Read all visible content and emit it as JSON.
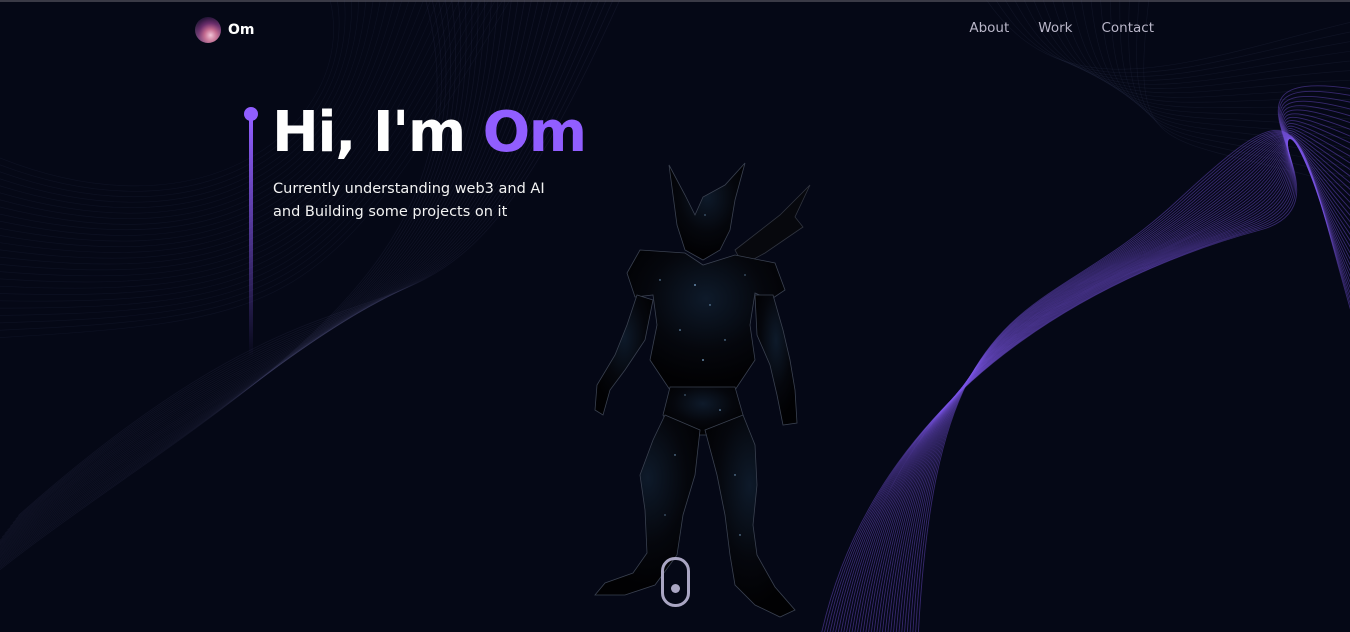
{
  "nav": {
    "brand_name": "Om",
    "links": [
      {
        "label": "About"
      },
      {
        "label": "Work"
      },
      {
        "label": "Contact"
      }
    ]
  },
  "hero": {
    "greeting": "Hi, I'm ",
    "name": "Om",
    "subtitle_line1": "Currently understanding web3 and AI",
    "subtitle_line2": "and Building some projects on it"
  },
  "colors": {
    "background": "#050816",
    "accent": "#915eff",
    "text_secondary": "#b9b6c8",
    "scroll_indicator": "#aaa6c3"
  },
  "icons": {
    "logo": "avatar-logo-icon",
    "scroll": "scroll-mouse-icon"
  }
}
